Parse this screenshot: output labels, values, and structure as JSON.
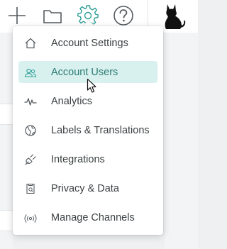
{
  "colors": {
    "accent": "#2b9e95",
    "active_bg": "#d8f1ee",
    "active_text": "#2b7a74",
    "text": "#3c4043",
    "icon": "#555a5e"
  },
  "topbar": {
    "icons": [
      "plus-icon",
      "folder-icon",
      "gear-icon",
      "help-icon"
    ],
    "avatar": "cat-avatar"
  },
  "settings_menu": {
    "active_index": 1,
    "items": [
      {
        "label": "Account Settings",
        "icon": "home-icon"
      },
      {
        "label": "Account Users",
        "icon": "users-icon"
      },
      {
        "label": "Analytics",
        "icon": "pulse-icon"
      },
      {
        "label": "Labels & Translations",
        "icon": "globe-icon"
      },
      {
        "label": "Integrations",
        "icon": "plug-icon"
      },
      {
        "label": "Privacy & Data",
        "icon": "shield-icon"
      },
      {
        "label": "Manage Channels",
        "icon": "broadcast-icon"
      }
    ]
  }
}
